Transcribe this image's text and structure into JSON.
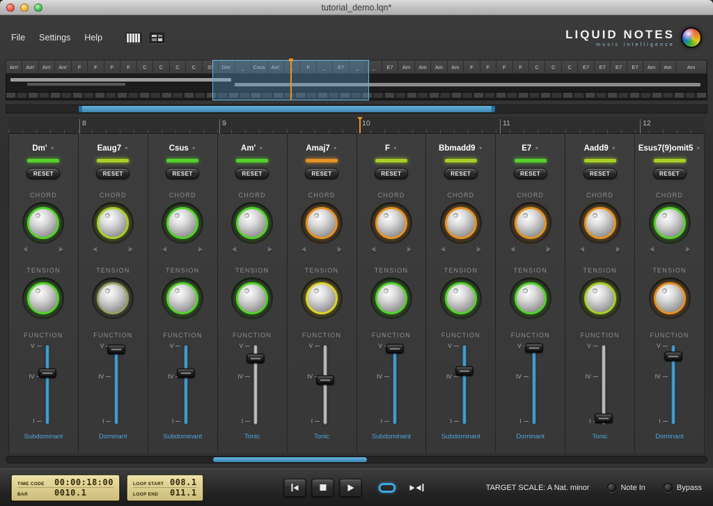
{
  "window": {
    "title": "tutorial_demo.lqn*"
  },
  "menu": {
    "items": [
      "File",
      "Settings",
      "Help"
    ]
  },
  "logo": {
    "title": "LIQUID NOTES",
    "subtitle": "music intelligence"
  },
  "icons": {
    "dropdown": "▼"
  },
  "overview": {
    "cells": [
      {
        "l": "Am'"
      },
      {
        "l": "Am'"
      },
      {
        "l": "Am'"
      },
      {
        "l": "Am'"
      },
      {
        "l": "F"
      },
      {
        "l": "F"
      },
      {
        "l": "F"
      },
      {
        "l": "F"
      },
      {
        "l": "C"
      },
      {
        "l": "C"
      },
      {
        "l": "C"
      },
      {
        "l": "C"
      },
      {
        "l": "G'"
      },
      {
        "l": "Dm'"
      },
      {
        "l": "_"
      },
      {
        "l": "Csus"
      },
      {
        "l": "Am'"
      },
      {
        "l": "_"
      },
      {
        "l": "F"
      },
      {
        "l": "_"
      },
      {
        "l": "E7"
      },
      {
        "l": "_"
      },
      {
        "l": "_"
      },
      {
        "l": "E7"
      },
      {
        "l": "Am"
      },
      {
        "l": "Am"
      },
      {
        "l": "Am"
      },
      {
        "l": "Am"
      },
      {
        "l": "F"
      },
      {
        "l": "F"
      },
      {
        "l": "F"
      },
      {
        "l": "F"
      },
      {
        "l": "C"
      },
      {
        "l": "C"
      },
      {
        "l": "C"
      },
      {
        "l": "E7"
      },
      {
        "l": "E7"
      },
      {
        "l": "E7"
      },
      {
        "l": "E7"
      },
      {
        "l": "Am"
      },
      {
        "l": "Am"
      },
      {
        "l": "Am",
        "wide": true
      }
    ],
    "selection": {
      "left_pct": 29.5,
      "width_pct": 22.3
    },
    "playhead_left_pct": 40.6
  },
  "timeline": {
    "left_pct": 10.3,
    "width_pct": 59.5
  },
  "ruler": {
    "marks": [
      {
        "label": "8",
        "x_pct": 10.2
      },
      {
        "label": "9",
        "x_pct": 30.3
      },
      {
        "label": "10",
        "x_pct": 50.4
      },
      {
        "label": "11",
        "x_pct": 70.6
      },
      {
        "label": "12",
        "x_pct": 90.7
      }
    ],
    "playhead_x_pct": 50.4
  },
  "labels": {
    "reset": "RESET",
    "chord_section": "CHORD",
    "tension_section": "TENSION",
    "function_section": "FUNCTION",
    "mark_v": "V",
    "mark_iv": "IV",
    "mark_i": "I"
  },
  "strips": [
    {
      "chord": "Dm'",
      "led": "#55d22c",
      "chord_ring": "#55d22c",
      "tension_ring": "#55d22c",
      "slider_color": "#46a3d9",
      "slider_pos": 0.36,
      "function": "Subdominant"
    },
    {
      "chord": "Eaug7",
      "led": "#a9cf27",
      "chord_ring": "#a9cf27",
      "tension_ring": "#98a063",
      "slider_color": "#46a3d9",
      "slider_pos": 0.07,
      "function": "Dominant"
    },
    {
      "chord": "Csus",
      "led": "#55d22c",
      "chord_ring": "#55d22c",
      "tension_ring": "#55d22c",
      "slider_color": "#46a3d9",
      "slider_pos": 0.36,
      "function": "Subdominant"
    },
    {
      "chord": "Am'",
      "led": "#55d22c",
      "chord_ring": "#55d22c",
      "tension_ring": "#55d22c",
      "slider_color": "#c2c2c2",
      "slider_pos": 0.18,
      "function": "Tonic"
    },
    {
      "chord": "Amaj7",
      "led": "#e59325",
      "chord_ring": "#e59325",
      "tension_ring": "#ddd22a",
      "slider_color": "#c2c2c2",
      "slider_pos": 0.44,
      "function": "Tonic"
    },
    {
      "chord": "F",
      "led": "#a9cf27",
      "chord_ring": "#e59325",
      "tension_ring": "#55d22c",
      "slider_color": "#46a3d9",
      "slider_pos": 0.06,
      "function": "Subdominant"
    },
    {
      "chord": "Bbmadd9",
      "led": "#a9cf27",
      "chord_ring": "#e59325",
      "tension_ring": "#55d22c",
      "slider_color": "#46a3d9",
      "slider_pos": 0.33,
      "function": "Subdominant"
    },
    {
      "chord": "E7",
      "led": "#55d22c",
      "chord_ring": "#e59325",
      "tension_ring": "#55d22c",
      "slider_color": "#46a3d9",
      "slider_pos": 0.05,
      "function": "Dominant"
    },
    {
      "chord": "Aadd9",
      "led": "#a9cf27",
      "chord_ring": "#e59325",
      "tension_ring": "#a9cf27",
      "slider_color": "#c2c2c2",
      "slider_pos": 0.91,
      "function": "Tonic"
    },
    {
      "chord": "Esus7(9)omit5",
      "led": "#a9cf27",
      "chord_ring": "#55d22c",
      "tension_ring": "#e59325",
      "slider_color": "#46a3d9",
      "slider_pos": 0.15,
      "function": "Dominant"
    }
  ],
  "hscroll": {
    "left_pct": 29.5,
    "width_pct": 22.0
  },
  "footer": {
    "time_code_label": "TIME CODE",
    "time_code": "00:00:18:00",
    "bar_label": "BAR",
    "bar": "0010.1",
    "loop_start_label": "LOOP START",
    "loop_start": "008.1",
    "loop_end_label": "LOOP END",
    "loop_end": "011.1",
    "target_scale": "TARGET SCALE: A Nat. minor",
    "note_in": "Note In",
    "bypass": "Bypass"
  }
}
